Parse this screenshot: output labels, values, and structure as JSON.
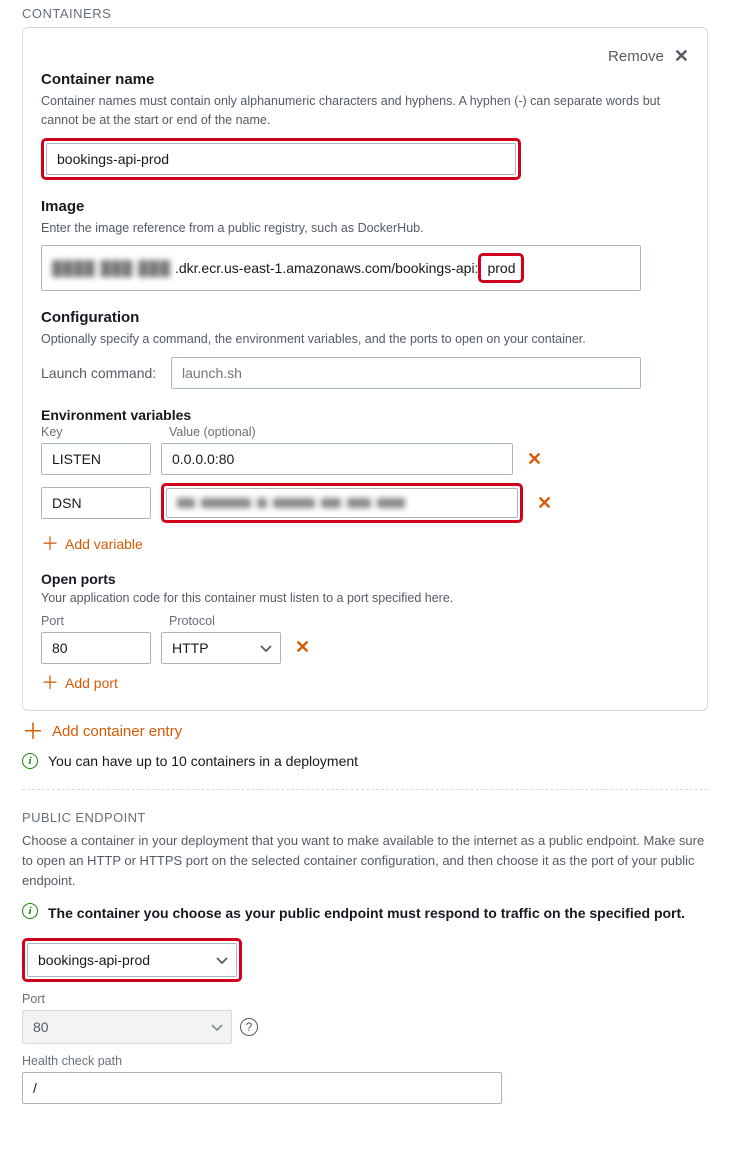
{
  "sections": {
    "containers_label": "CONTAINERS",
    "public_endpoint_label": "PUBLIC ENDPOINT"
  },
  "container": {
    "remove_label": "Remove",
    "name_label": "Container name",
    "name_hint": "Container names must contain only alphanumeric characters and hyphens. A hyphen (-) can separate words but cannot be at the start or end of the name.",
    "name_value": "bookings-api-prod",
    "image_label": "Image",
    "image_hint": "Enter the image reference from a public registry, such as DockerHub.",
    "image_obscured_prefix": "████ ███ ███",
    "image_middle": ".dkr.ecr.us-east-1.amazonaws.com/bookings-api:",
    "image_highlight_suffix": "prod",
    "config_label": "Configuration",
    "config_hint": "Optionally specify a command, the environment variables, and the ports to open on your container.",
    "launch_label": "Launch command:",
    "launch_placeholder": "launch.sh",
    "env_label": "Environment variables",
    "env_key_col": "Key",
    "env_val_col": "Value (optional)",
    "env_rows": [
      {
        "key": "LISTEN",
        "value": "0.0.0.0:80",
        "obscured": false
      },
      {
        "key": "DSN",
        "value": "",
        "obscured": true
      }
    ],
    "add_variable_label": "Add variable",
    "open_ports_label": "Open ports",
    "open_ports_hint": "Your application code for this container must listen to a port specified here.",
    "port_col": "Port",
    "protocol_col": "Protocol",
    "port_value": "80",
    "protocol_value": "HTTP",
    "add_port_label": "Add port"
  },
  "outer": {
    "add_container_label": "Add container entry",
    "limit_info": "You can have up to 10 containers in a deployment"
  },
  "public_endpoint": {
    "desc": "Choose a container in your deployment that you want to make available to the internet as a public endpoint. Make sure to open an HTTP or HTTPS port on the selected container configuration, and then choose it as the port of your public endpoint.",
    "info_text": "The container you choose as your public endpoint must respond to traffic on the specified port.",
    "container_value": "bookings-api-prod",
    "port_label": "Port",
    "port_value": "80",
    "health_label": "Health check path",
    "health_value": "/"
  }
}
